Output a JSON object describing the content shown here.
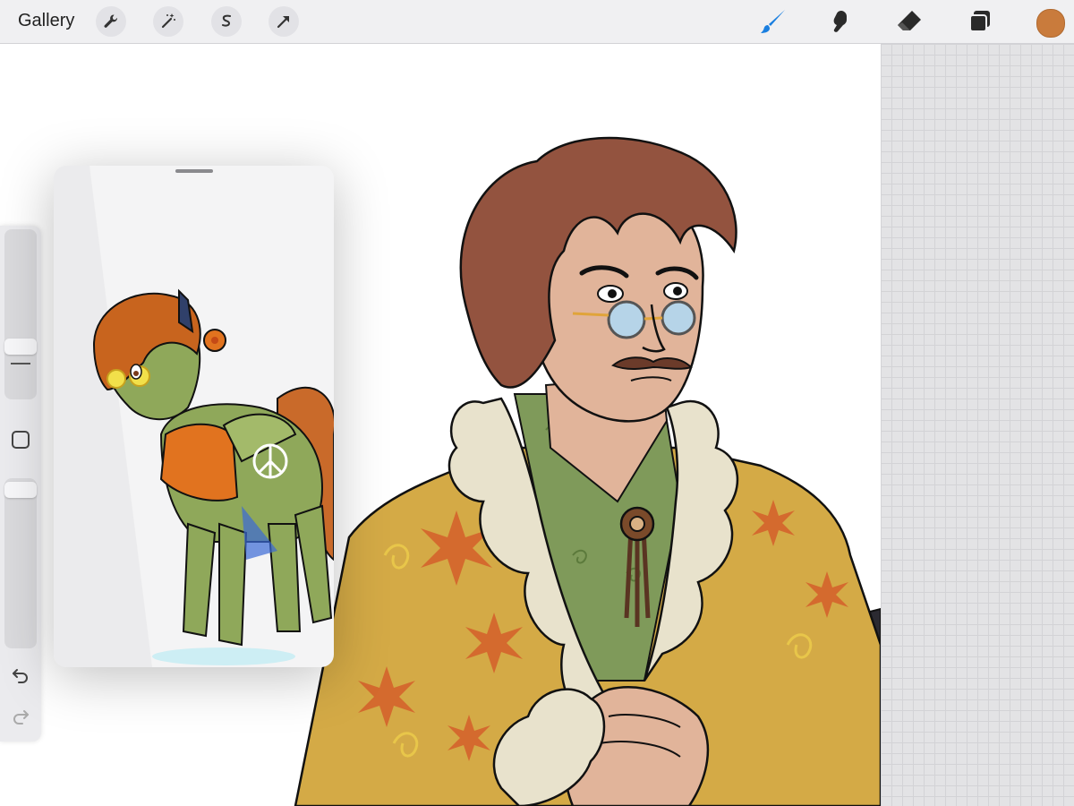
{
  "toolbar": {
    "gallery_label": "Gallery",
    "left_tools": [
      "wrench-icon",
      "magic-wand-icon",
      "selection-icon",
      "transform-arrow-icon"
    ],
    "right_tools": [
      "brush-icon",
      "smudge-icon",
      "eraser-icon",
      "layers-icon"
    ],
    "active_tool": "brush-icon",
    "current_color": "#c97b3c",
    "accent_color": "#1a7fe0"
  },
  "sidebar": {
    "brush_size_slider": "brush-size",
    "modify_button": "modify-square-icon",
    "opacity_slider": "opacity",
    "undo": "undo-icon",
    "redo": "redo-icon"
  },
  "reference_window": {
    "grabber": "drag-handle"
  }
}
